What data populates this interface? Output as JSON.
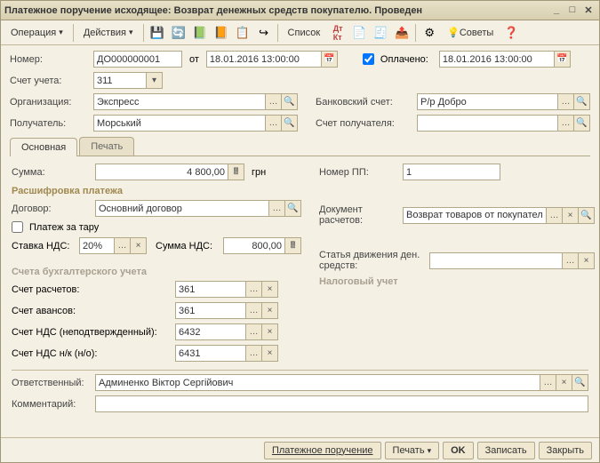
{
  "title": "Платежное поручение исходящее: Возврат денежных средств покупателю. Проведен",
  "menu": {
    "operation": "Операция",
    "actions": "Действия",
    "list": "Список",
    "tips": "Советы"
  },
  "form": {
    "number_lbl": "Номер:",
    "number": "ДО000000001",
    "from": "от",
    "date1": "18.01.2016 13:00:00",
    "paid_lbl": "Оплачено:",
    "date2": "18.01.2016 13:00:00",
    "acct_lbl": "Счет учета:",
    "acct": "311",
    "org_lbl": "Организация:",
    "org": "Экспресс",
    "bank_lbl": "Банковский счет:",
    "bank": "Р/р Добро",
    "recv_lbl": "Получатель:",
    "recv": "Морський",
    "recvacct_lbl": "Счет получателя:",
    "recvacct": ""
  },
  "tabs": {
    "main": "Основная",
    "print": "Печать"
  },
  "main": {
    "sum_lbl": "Сумма:",
    "sum": "4 800,00",
    "curr": "грн",
    "pp_lbl": "Номер ПП:",
    "pp": "1",
    "decode": "Расшифровка платежа",
    "contract_lbl": "Договор:",
    "contract": "Основний договор",
    "docpay_lbl": "Документ расчетов:",
    "docpay": "Возврат товаров от покупателя ",
    "tare": "Платеж за тару",
    "vatrate_lbl": "Ставка НДС:",
    "vatrate": "20%",
    "vatsum_lbl": "Сумма НДС:",
    "vatsum": "800,00",
    "cashflow_lbl": "Статья движения ден. средств:",
    "cashflow": "",
    "tax": "Налоговый учет",
    "accts": "Счета бухгалтерского учета",
    "a1_lbl": "Счет расчетов:",
    "a1": "361",
    "a2_lbl": "Счет авансов:",
    "a2": "361",
    "a3_lbl": "Счет НДС (неподтвержденный):",
    "a3": "6432",
    "a4_lbl": "Счет НДС н/к (н/о):",
    "a4": "6431",
    "resp_lbl": "Ответственный:",
    "resp": "Админенко Віктор Сергійович",
    "comment_lbl": "Комментарий:",
    "comment": ""
  },
  "footer": {
    "porder": "Платежное поручение",
    "print": "Печать",
    "ok": "OK",
    "save": "Записать",
    "close": "Закрыть"
  }
}
